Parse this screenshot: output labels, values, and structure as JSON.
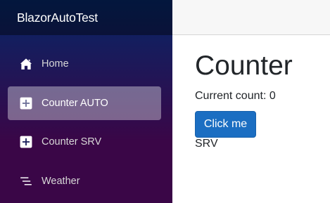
{
  "app": {
    "brand": "BlazorAutoTest"
  },
  "sidebar": {
    "items": [
      {
        "label": "Home",
        "icon": "house-icon",
        "active": false
      },
      {
        "label": "Counter AUTO",
        "icon": "plus-square-icon",
        "active": true
      },
      {
        "label": "Counter SRV",
        "icon": "plus-square-icon",
        "active": false
      },
      {
        "label": "Weather",
        "icon": "list-nested-icon",
        "active": false
      }
    ]
  },
  "main": {
    "title": "Counter",
    "count_text": "Current count: 0",
    "button_label": "Click me",
    "render_mode": "SRV"
  },
  "colors": {
    "sidebar_top": "#052767",
    "sidebar_bottom": "#3a0647",
    "primary_button": "#1b6ec2",
    "top_row": "#f7f7f7"
  }
}
